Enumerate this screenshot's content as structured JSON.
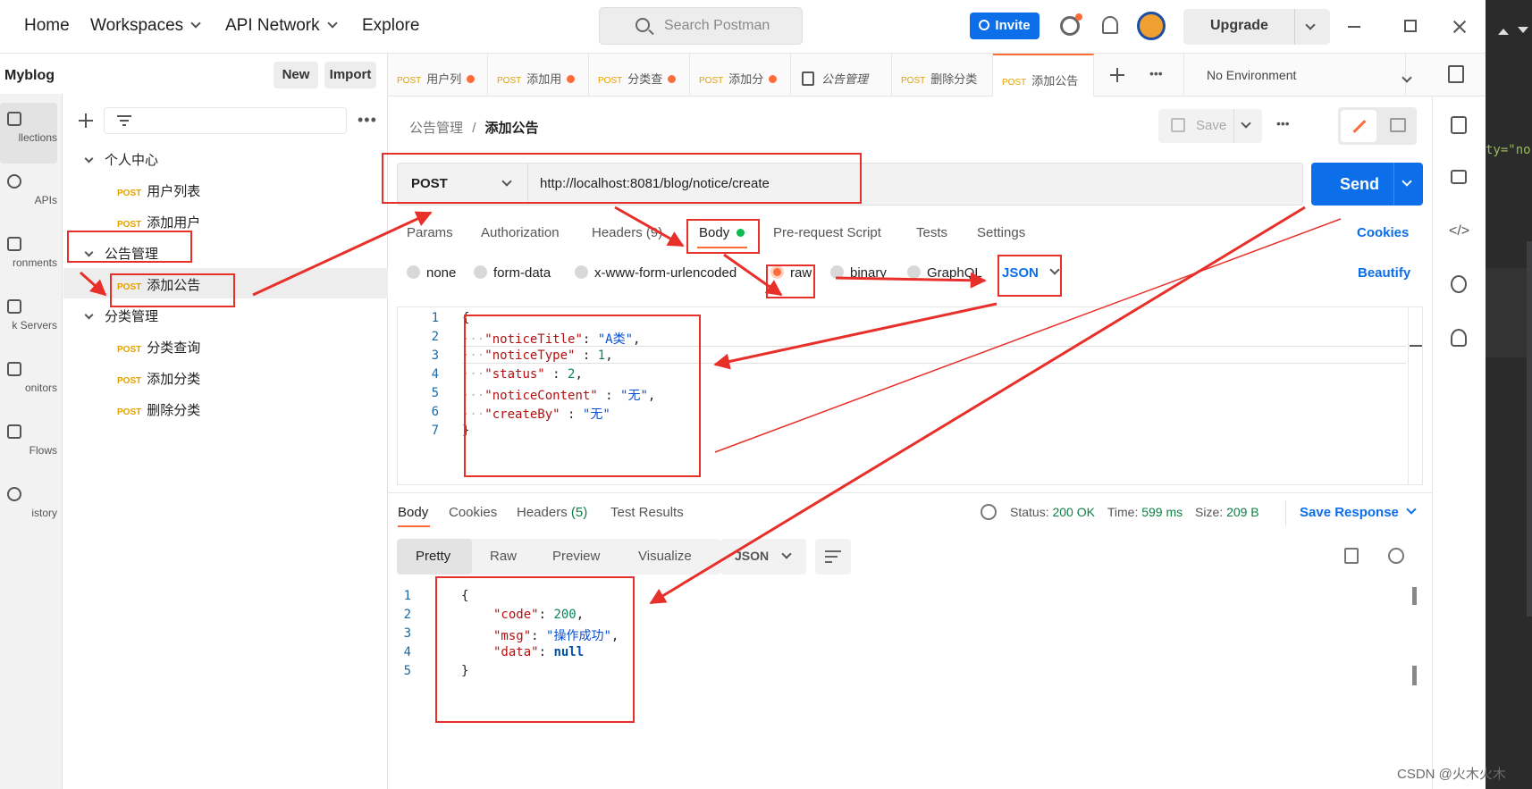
{
  "topbar": {
    "home": "Home",
    "workspaces": "Workspaces",
    "api_network": "API Network",
    "explore": "Explore",
    "search_placeholder": "Search Postman",
    "invite": "Invite",
    "upgrade": "Upgrade"
  },
  "sidebar": {
    "workspace_name": "Myblog",
    "new_label": "New",
    "import_label": "Import",
    "icon_items": [
      "llections",
      "APIs",
      "ronments",
      "k Servers",
      "onitors",
      "Flows",
      "istory"
    ],
    "tree": [
      {
        "name": "个人中心",
        "requests": [
          {
            "method": "POST",
            "name": "用户列表"
          },
          {
            "method": "POST",
            "name": "添加用户"
          }
        ]
      },
      {
        "name": "公告管理",
        "requests": [
          {
            "method": "POST",
            "name": "添加公告"
          }
        ]
      },
      {
        "name": "分类管理",
        "requests": [
          {
            "method": "POST",
            "name": "分类查询"
          },
          {
            "method": "POST",
            "name": "添加分类"
          },
          {
            "method": "POST",
            "name": "删除分类"
          }
        ]
      }
    ]
  },
  "tabs": [
    {
      "method": "POST",
      "name": "用户列"
    },
    {
      "method": "POST",
      "name": "添加用"
    },
    {
      "method": "POST",
      "name": "分类查"
    },
    {
      "method": "POST",
      "name": "添加分"
    },
    {
      "method": "",
      "name": "公告管理"
    },
    {
      "method": "POST",
      "name": "删除分类"
    },
    {
      "method": "POST",
      "name": "添加公告"
    }
  ],
  "environment": "No Environment",
  "request": {
    "breadcrumb_parent": "公告管理",
    "breadcrumb_sep": "/",
    "breadcrumb_current": "添加公告",
    "save_label": "Save",
    "method": "POST",
    "url": "http://localhost:8081/blog/notice/create",
    "send_label": "Send",
    "subtabs": {
      "params": "Params",
      "authorization": "Authorization",
      "headers": "Headers (9)",
      "body": "Body",
      "pre_request": "Pre-request Script",
      "tests": "Tests",
      "settings": "Settings"
    },
    "cookies_link": "Cookies",
    "body_modes": {
      "none": "none",
      "form_data": "form-data",
      "urlencoded": "x-www-form-urlencoded",
      "raw": "raw",
      "binary": "binary",
      "graphql": "GraphQL"
    },
    "raw_format": "JSON",
    "beautify": "Beautify",
    "line_numbers": [
      "1",
      "2",
      "3",
      "4",
      "5",
      "6",
      "7"
    ],
    "body_lines": {
      "open": "{",
      "k1": "\"noticeTitle\"",
      "v1": "\"A类\"",
      "k2": "\"noticeType\"",
      "v2": "1",
      "k3": "\"status\"",
      "v3": "2",
      "k4": "\"noticeContent\"",
      "v4": "\"无\"",
      "k5": "\"createBy\"",
      "v5": "\"无\"",
      "close": "}"
    }
  },
  "response": {
    "tabs": {
      "body": "Body",
      "cookies": "Cookies",
      "headers": "Headers",
      "headers_count": "(5)",
      "test_results": "Test Results"
    },
    "status_label": "Status:",
    "status_value": "200 OK",
    "time_label": "Time:",
    "time_value": "599 ms",
    "size_label": "Size:",
    "size_value": "209 B",
    "save_response": "Save Response",
    "view_tabs": {
      "pretty": "Pretty",
      "raw": "Raw",
      "preview": "Preview",
      "visualize": "Visualize"
    },
    "format": "JSON",
    "line_numbers": [
      "1",
      "2",
      "3",
      "4",
      "5"
    ],
    "body_lines": {
      "open": "{",
      "k1": "\"code\"",
      "v1": "200",
      "k2": "\"msg\"",
      "v2": "\"操作成功\"",
      "k3": "\"data\"",
      "v3": "null",
      "close": "}"
    }
  },
  "watermark": "CSDN @火木火木",
  "colors": {
    "accent": "#ff6c37",
    "primary": "#0c6ee9",
    "annotation": "#e8302a",
    "status_ok": "#0d8043"
  }
}
